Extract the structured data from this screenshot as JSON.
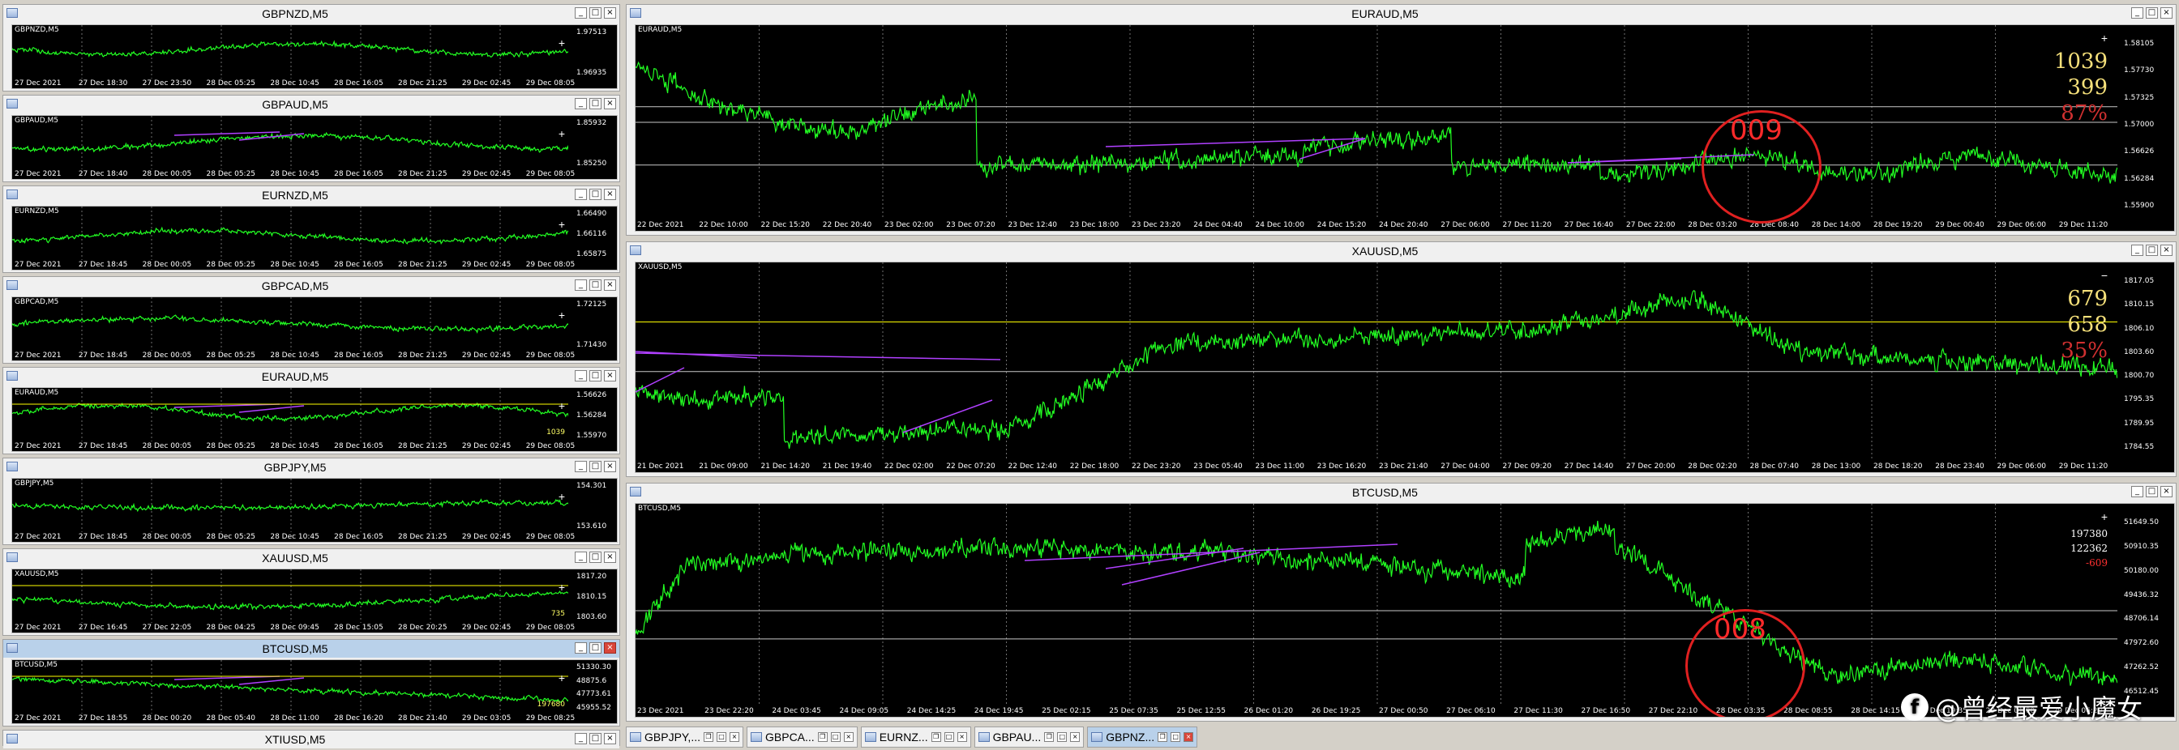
{
  "colors": {
    "bg": "#000000",
    "line": "#22ff22",
    "purple": "#b040ff",
    "yellow_level": "#ffff00",
    "grid": "#555555",
    "red_circle": "#e02020"
  },
  "left_windows": [
    {
      "title": "GBPNZD,M5",
      "sym": "GBPNZD,M5",
      "prices": [
        "1.97513",
        "1.96935"
      ],
      "times": [
        "27 Dec 2021",
        "27 Dec 18:30",
        "27 Dec 23:50",
        "28 Dec 05:25",
        "28 Dec 10:45",
        "28 Dec 16:05",
        "28 Dec 21:25",
        "29 Dec 02:45",
        "29 Dec 08:05"
      ],
      "tags": [],
      "extra": ""
    },
    {
      "title": "GBPAUD,M5",
      "sym": "GBPAUD,M5",
      "prices": [
        "1.85932",
        "1.85250"
      ],
      "times": [
        "27 Dec 2021",
        "27 Dec 18:40",
        "28 Dec 00:05",
        "28 Dec 05:25",
        "28 Dec 10:45",
        "28 Dec 16:05",
        "28 Dec 21:25",
        "29 Dec 02:45",
        "29 Dec 08:05"
      ],
      "tags": [],
      "extra": ""
    },
    {
      "title": "EURNZD,M5",
      "sym": "EURNZD,M5",
      "prices": [
        "1.66490",
        "1.66116",
        "1.65875"
      ],
      "times": [
        "27 Dec 2021",
        "27 Dec 18:45",
        "28 Dec 00:05",
        "28 Dec 05:25",
        "28 Dec 10:45",
        "28 Dec 16:05",
        "28 Dec 21:25",
        "29 Dec 02:45",
        "29 Dec 08:05"
      ],
      "tags": [],
      "extra": ""
    },
    {
      "title": "GBPCAD,M5",
      "sym": "GBPCAD,M5",
      "prices": [
        "1.72125",
        "1.71430"
      ],
      "times": [
        "27 Dec 2021",
        "27 Dec 18:45",
        "28 Dec 00:05",
        "28 Dec 05:25",
        "28 Dec 10:45",
        "28 Dec 16:05",
        "28 Dec 21:25",
        "29 Dec 02:45",
        "29 Dec 08:05"
      ],
      "tags": [],
      "extra": ""
    },
    {
      "title": "EURAUD,M5",
      "sym": "EURAUD,M5",
      "prices": [
        "1.56626",
        "1.56284",
        "1.55970"
      ],
      "times": [
        "27 Dec 2021",
        "27 Dec 18:45",
        "28 Dec 00:05",
        "28 Dec 05:25",
        "28 Dec 10:45",
        "28 Dec 16:05",
        "28 Dec 21:25",
        "29 Dec 02:45",
        "29 Dec 08:05"
      ],
      "tags": [],
      "extra": "1039"
    },
    {
      "title": "GBPJPY,M5",
      "sym": "GBPJPY,M5",
      "prices": [
        "154.301",
        "153.610"
      ],
      "times": [
        "27 Dec 2021",
        "27 Dec 18:45",
        "28 Dec 00:05",
        "28 Dec 05:25",
        "28 Dec 10:45",
        "28 Dec 16:05",
        "28 Dec 21:25",
        "29 Dec 02:45",
        "29 Dec 08:05"
      ],
      "tags": [],
      "extra": ""
    },
    {
      "title": "XAUUSD,M5",
      "sym": "XAUUSD,M5",
      "prices": [
        "1817.20",
        "1810.15",
        "1803.60"
      ],
      "times": [
        "27 Dec 2021",
        "27 Dec 16:45",
        "27 Dec 22:05",
        "28 Dec 04:25",
        "28 Dec 09:45",
        "28 Dec 15:05",
        "28 Dec 20:25",
        "29 Dec 02:45",
        "29 Dec 08:05"
      ],
      "tags": [],
      "extra": "735"
    },
    {
      "title": "BTCUSD,M5",
      "sym": "BTCUSD,M5",
      "prices": [
        "51330.30",
        "48875.6",
        "47773.61",
        "45955.52"
      ],
      "times": [
        "27 Dec 2021",
        "27 Dec 18:55",
        "28 Dec 00:20",
        "28 Dec 05:40",
        "28 Dec 11:00",
        "28 Dec 16:20",
        "28 Dec 21:40",
        "29 Dec 03:05",
        "29 Dec 08:25"
      ],
      "tags": [],
      "extra": "197680"
    },
    {
      "title": "XTIUSD,M5"
    }
  ],
  "right_windows": [
    {
      "title": "EURAUD,M5",
      "sym": "EURAUD,M5",
      "prices": [
        "1.58105",
        "1.57730",
        "1.57325",
        "1.57000",
        "1.56626",
        "1.56284",
        "1.55900"
      ],
      "times": [
        "22 Dec 2021",
        "22 Dec 10:00",
        "22 Dec 15:20",
        "22 Dec 20:40",
        "23 Dec 02:00",
        "23 Dec 07:20",
        "23 Dec 12:40",
        "23 Dec 18:00",
        "23 Dec 23:20",
        "24 Dec 04:40",
        "24 Dec 10:00",
        "24 Dec 15:20",
        "24 Dec 20:40",
        "27 Dec 06:00",
        "27 Dec 11:20",
        "27 Dec 16:40",
        "27 Dec 22:00",
        "28 Dec 03:20",
        "28 Dec 08:40",
        "28 Dec 14:00",
        "28 Dec 19:20",
        "29 Dec 00:40",
        "29 Dec 06:00",
        "29 Dec 11:20"
      ],
      "big": [
        "1039",
        "399",
        "87%"
      ],
      "circle": "009"
    },
    {
      "title": "XAUUSD,M5",
      "sym": "XAUUSD,M5",
      "prices": [
        "1817.05",
        "1810.15",
        "1806.10",
        "1803.60",
        "1800.70",
        "1795.35",
        "1789.95",
        "1784.55"
      ],
      "times": [
        "21 Dec 2021",
        "21 Dec 09:00",
        "21 Dec 14:20",
        "21 Dec 19:40",
        "22 Dec 02:00",
        "22 Dec 07:20",
        "22 Dec 12:40",
        "22 Dec 18:00",
        "22 Dec 23:20",
        "23 Dec 05:40",
        "23 Dec 11:00",
        "23 Dec 16:20",
        "23 Dec 21:40",
        "27 Dec 04:00",
        "27 Dec 09:20",
        "27 Dec 14:40",
        "27 Dec 20:00",
        "28 Dec 02:20",
        "28 Dec 07:40",
        "28 Dec 13:00",
        "28 Dec 18:20",
        "28 Dec 23:40",
        "29 Dec 06:00",
        "29 Dec 11:20"
      ],
      "big": [
        "679",
        "658",
        "35%"
      ],
      "circle": ""
    },
    {
      "title": "BTCUSD,M5",
      "sym": "BTCUSD,M5",
      "prices": [
        "51649.50",
        "50910.35",
        "50180.00",
        "49436.32",
        "48706.14",
        "47972.60",
        "47262.52",
        "46512.45"
      ],
      "times": [
        "23 Dec 2021",
        "23 Dec 22:20",
        "24 Dec 03:45",
        "24 Dec 09:05",
        "24 Dec 14:25",
        "24 Dec 19:45",
        "25 Dec 02:15",
        "25 Dec 07:35",
        "25 Dec 12:55",
        "26 Dec 01:20",
        "26 Dec 19:25",
        "27 Dec 00:50",
        "27 Dec 06:10",
        "27 Dec 11:30",
        "27 Dec 16:50",
        "27 Dec 22:10",
        "28 Dec 03:35",
        "28 Dec 08:55",
        "28 Dec 14:15",
        "28 Dec 19:35",
        "29 Dec 01:00",
        "29 Dec 06:20"
      ],
      "big": [
        "197380",
        "122362",
        "-609"
      ],
      "circle": "008"
    }
  ],
  "taskbar": [
    {
      "label": "GBPJPY,..."
    },
    {
      "label": "GBPCA..."
    },
    {
      "label": "EURNZ..."
    },
    {
      "label": "GBPAU..."
    },
    {
      "label": "GBPNZ..."
    }
  ],
  "window_controls": {
    "min": "_",
    "max": "□",
    "close": "×",
    "restore": "❐"
  },
  "watermark": {
    "logo": "f",
    "text": "@曾经最爱小魔女"
  },
  "plus_sign": "+",
  "minus_sign": "−"
}
